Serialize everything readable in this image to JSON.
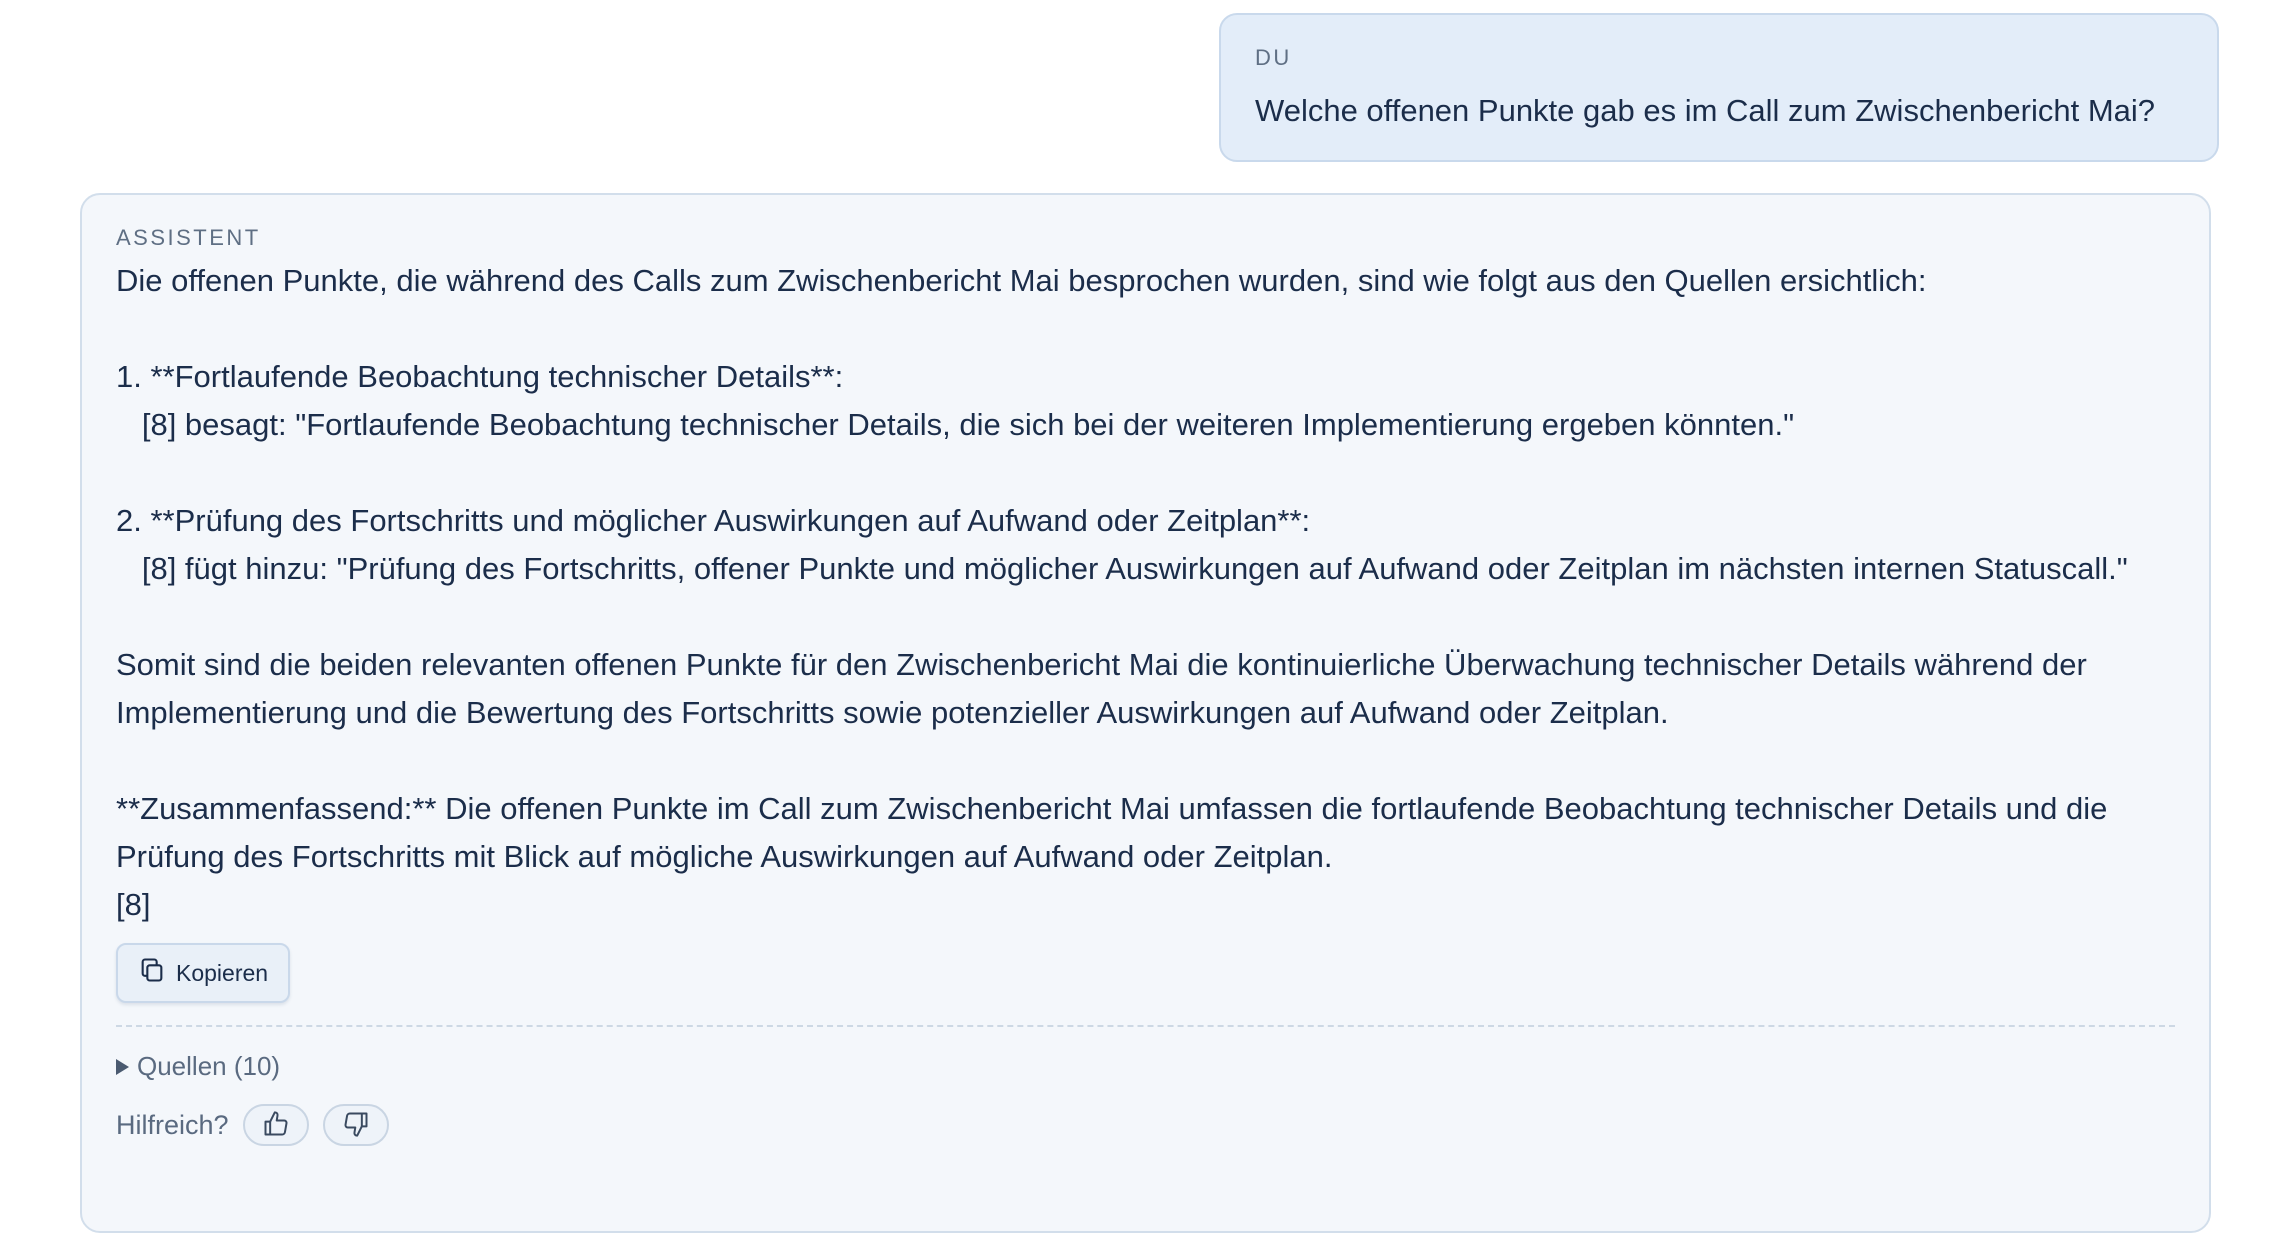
{
  "user_message": {
    "role_label": "DU",
    "text": "Welche offenen Punkte gab es im Call zum Zwischenbericht Mai?"
  },
  "assistant_message": {
    "role_label": "ASSISTENT",
    "intro": "Die offenen Punkte, die während des Calls zum Zwischenbericht Mai besprochen wurden, sind wie folgt aus den Quellen ersichtlich:",
    "point1_title": "1. **Fortlaufende Beobachtung technischer Details**:",
    "point1_quote": "   [8] besagt: \"Fortlaufende Beobachtung technischer Details, die sich bei der weiteren Implementierung ergeben könnten.\"",
    "point2_title": "2. **Prüfung des Fortschritts und möglicher Auswirkungen auf Aufwand oder Zeitplan**:",
    "point2_quote": "   [8] fügt hinzu: \"Prüfung des Fortschritts, offener Punkte und möglicher Auswirkungen auf Aufwand oder Zeitplan im nächsten internen Statuscall.\"",
    "conclusion": "Somit sind die beiden relevanten offenen Punkte für den Zwischenbericht Mai die kontinuierliche Überwachung technischer Details während der Implementierung und die Bewertung des Fortschritts sowie potenzieller Auswirkungen auf Aufwand oder Zeitplan.",
    "summary": "**Zusammenfassend:** Die offenen Punkte im Call zum Zwischenbericht Mai umfassen die fortlaufende Beobachtung technischer Details und die Prüfung des Fortschritts mit Blick auf mögliche Auswirkungen auf Aufwand oder Zeitplan.",
    "citation": "[8]",
    "copy_label": "Kopieren",
    "sources_label": "Quellen (10)",
    "feedback_label": "Hilfreich?",
    "icons": {
      "copy": "copy-icon",
      "sources_toggle": "triangle-right-icon",
      "thumbs_up": "thumbs-up-icon",
      "thumbs_down": "thumbs-down-icon"
    }
  },
  "colors": {
    "user_bubble_bg": "#e3edf9",
    "assistant_card_bg": "#f4f7fb",
    "text": "#1b2d4a",
    "muted": "#5a6a80"
  }
}
